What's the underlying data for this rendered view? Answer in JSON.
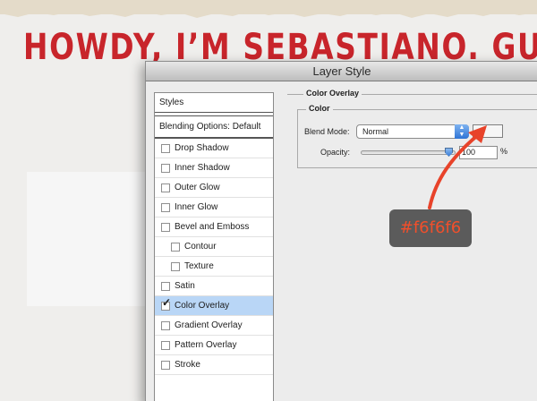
{
  "page": {
    "headline": "HOWDY, I’M SEBASTIANO. GU"
  },
  "dialog": {
    "title": "Layer Style",
    "styles_panel": {
      "header": "Styles",
      "blending_options": "Blending Options: Default",
      "items": [
        {
          "label": "Drop Shadow",
          "checked": false
        },
        {
          "label": "Inner Shadow",
          "checked": false
        },
        {
          "label": "Outer Glow",
          "checked": false
        },
        {
          "label": "Inner Glow",
          "checked": false
        },
        {
          "label": "Bevel and Emboss",
          "checked": false
        },
        {
          "label": "Contour",
          "checked": false
        },
        {
          "label": "Texture",
          "checked": false
        },
        {
          "label": "Satin",
          "checked": false
        },
        {
          "label": "Color Overlay",
          "checked": true,
          "selected": true
        },
        {
          "label": "Gradient Overlay",
          "checked": false
        },
        {
          "label": "Pattern Overlay",
          "checked": false
        },
        {
          "label": "Stroke",
          "checked": false
        }
      ]
    },
    "color_overlay": {
      "section_title": "Color Overlay",
      "group_title": "Color",
      "blend_mode_label": "Blend Mode:",
      "blend_mode_value": "Normal",
      "swatch_color": "#f6f6f6",
      "opacity_label": "Opacity:",
      "opacity_value": "100",
      "opacity_unit": "%"
    }
  },
  "annotation": {
    "text": "#f6f6f6"
  },
  "colors": {
    "headline": "#c8252b",
    "selection": "#b9d6f6",
    "annotation_bg": "#5b5b5b",
    "annotation_text": "#f24f2b",
    "arrow": "#e8432a"
  }
}
